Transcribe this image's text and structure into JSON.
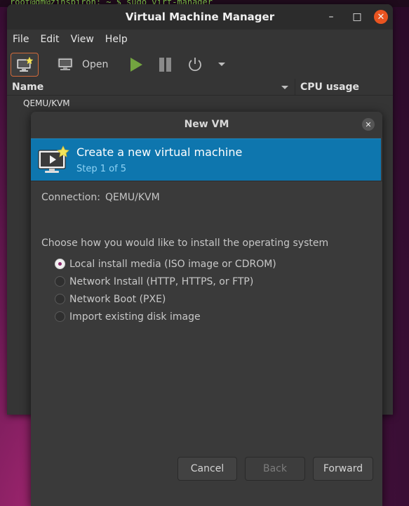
{
  "terminal": {
    "text": "root@dm@zinspiron: ~ $ sudo virt-manager"
  },
  "main_window": {
    "title": "Virtual Machine Manager",
    "window_controls": {
      "minimize": "–",
      "maximize": "□",
      "close": "✕"
    },
    "menu": [
      "File",
      "Edit",
      "View",
      "Help"
    ],
    "toolbar": {
      "open_label": "Open"
    },
    "list": {
      "columns": {
        "name": "Name",
        "cpu": "CPU usage"
      },
      "connection": "QEMU/KVM"
    }
  },
  "dialog": {
    "title": "New VM",
    "close": "✕",
    "banner": {
      "heading": "Create a new virtual machine",
      "step": "Step 1 of 5"
    },
    "connection_label": "Connection:",
    "connection_value": "QEMU/KVM",
    "prompt": "Choose how you would like to install the operating system",
    "options": [
      {
        "label": "Local install media (ISO image or CDROM)",
        "checked": true
      },
      {
        "label": "Network Install (HTTP, HTTPS, or FTP)",
        "checked": false
      },
      {
        "label": "Network Boot (PXE)",
        "checked": false
      },
      {
        "label": "Import existing disk image",
        "checked": false
      }
    ],
    "buttons": {
      "cancel": "Cancel",
      "back": "Back",
      "forward": "Forward"
    }
  },
  "colors": {
    "accent": "#e95420",
    "banner": "#0e76ae",
    "play": "#73a440",
    "radio_checked": "#8b2a6b"
  }
}
